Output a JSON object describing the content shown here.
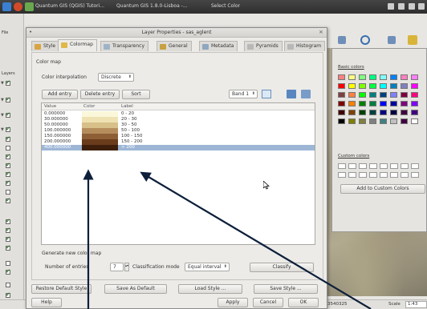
{
  "taskbar": {
    "items": [
      "Quantum GIS (QGIS) Tutori...",
      "Quantum GIS 1.8.0-Lisboa -...",
      "Select Color"
    ]
  },
  "qgis": {
    "menu_first": "File",
    "sidebar_label": "Layers",
    "status": {
      "coords": "3540325",
      "scale_label": "Scale",
      "scale_value": "1:43"
    }
  },
  "color_dialog": {
    "basic_colors_label": "Basic colors",
    "custom_colors_label": "Custom colors",
    "add_custom_button": "Add to Custom Colors",
    "swatches": [
      "#ff8080",
      "#ffff80",
      "#80ff80",
      "#00ff80",
      "#80ffff",
      "#0080ff",
      "#ff80c0",
      "#ff80ff",
      "#ff0000",
      "#ffff00",
      "#80ff00",
      "#00ff40",
      "#00ffff",
      "#0080c0",
      "#8080c0",
      "#ff00ff",
      "#804040",
      "#ff8040",
      "#00ff00",
      "#008080",
      "#004080",
      "#8080ff",
      "#800040",
      "#ff0080",
      "#800000",
      "#ff8000",
      "#008000",
      "#008040",
      "#0000ff",
      "#0000a0",
      "#800080",
      "#8000ff",
      "#400000",
      "#804000",
      "#004000",
      "#004040",
      "#000080",
      "#000040",
      "#400040",
      "#400080",
      "#000000",
      "#808000",
      "#808040",
      "#808080",
      "#408080",
      "#c0c0c0",
      "#400040",
      "#ffffff"
    ]
  },
  "dialog": {
    "title": "Layer Properties - sas_aglent",
    "tabs": [
      "Style",
      "Colormap",
      "Transparency",
      "General",
      "Metadata",
      "Pyramids",
      "Histogram"
    ],
    "section_title": "Color map",
    "interp_label": "Color interpolation",
    "interp_value": "Discrete",
    "add_entry": "Add entry",
    "delete_entry": "Delete entry",
    "sort": "Sort",
    "band_value": "Band 1",
    "columns": {
      "value": "Value",
      "color": "Color",
      "label": "Label"
    },
    "rows": [
      {
        "value": "0.000000",
        "color": "#fbf7da",
        "label": "0 - 20"
      },
      {
        "value": "30.000000",
        "color": "#efe2b2",
        "label": "20 - 30"
      },
      {
        "value": "50.000000",
        "color": "#d8c08a",
        "label": "30 - 50"
      },
      {
        "value": "100.000000",
        "color": "#b58d5c",
        "label": "50 - 100"
      },
      {
        "value": "150.000000",
        "color": "#8e5f36",
        "label": "100 - 150"
      },
      {
        "value": "200.000000",
        "color": "#6a3c1c",
        "label": "150 - 200"
      },
      {
        "value": "400.000000",
        "color": "#3e1f0c",
        "label": "> 200"
      }
    ],
    "generate_title": "Generate new color map",
    "num_entries_label": "Number of entries",
    "num_entries_value": "7",
    "class_mode_label": "Classification mode",
    "class_mode_value": "Equal interval",
    "classify": "Classify",
    "restore_default": "Restore Default Style",
    "save_default": "Save As Default",
    "load_style": "Load Style ...",
    "save_style": "Save Style ...",
    "help": "Help",
    "apply": "Apply",
    "cancel": "Cancel",
    "ok": "OK"
  }
}
